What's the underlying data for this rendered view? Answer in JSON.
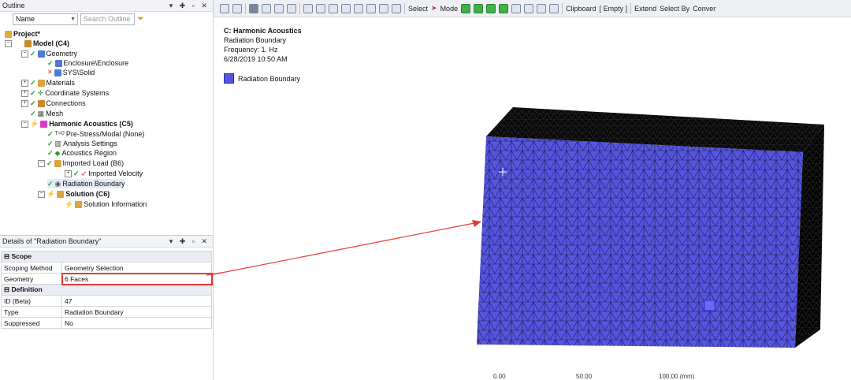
{
  "outline": {
    "title": "Outline",
    "name_filter": "Name",
    "search_placeholder": "Search Outline",
    "tree": {
      "project": "Project*",
      "model": "Model (C4)",
      "geometry": "Geometry",
      "geo_child1": "Enclosure\\Enclosure",
      "geo_child2": "SYS\\Solid",
      "materials": "Materials",
      "coordinate_systems": "Coordinate Systems",
      "connections": "Connections",
      "mesh": "Mesh",
      "harmonic": "Harmonic Acoustics (C5)",
      "prestress": "Pre-Stress/Modal (None)",
      "analysis_settings": "Analysis Settings",
      "acoustics_region": "Acoustics Region",
      "imported_load": "Imported Load (B6)",
      "imported_velocity": "Imported Velocity",
      "radiation_boundary": "Radiation Boundary",
      "solution": "Solution (C6)",
      "solution_information": "Solution Information"
    }
  },
  "details": {
    "title": "Details of \"Radiation Boundary\"",
    "groups": {
      "scope": "Scope",
      "definition": "Definition"
    },
    "rows": {
      "scoping_method_k": "Scoping Method",
      "scoping_method_v": "Geometry Selection",
      "geometry_k": "Geometry",
      "geometry_v": "6 Faces",
      "id_k": "ID (Beta)",
      "id_v": "47",
      "type_k": "Type",
      "type_v": "Radiation Boundary",
      "suppressed_k": "Suppressed",
      "suppressed_v": "No"
    }
  },
  "toolbar": {
    "select": "Select",
    "mode": "Mode",
    "clipboard": "Clipboard",
    "empty": "[ Empty ]",
    "extend": "Extend",
    "select_by": "Select By",
    "convert": "Conver"
  },
  "graphics": {
    "heading": "C: Harmonic Acoustics",
    "object": "Radiation Boundary",
    "frequency": "Frequency: 1. Hz",
    "timestamp": "6/28/2019 10:50 AM",
    "legend_label": "Radiation Boundary",
    "legend_color": "#5656e0",
    "ruler": [
      "0.00",
      "50.00",
      "100.00 (mm)"
    ]
  }
}
